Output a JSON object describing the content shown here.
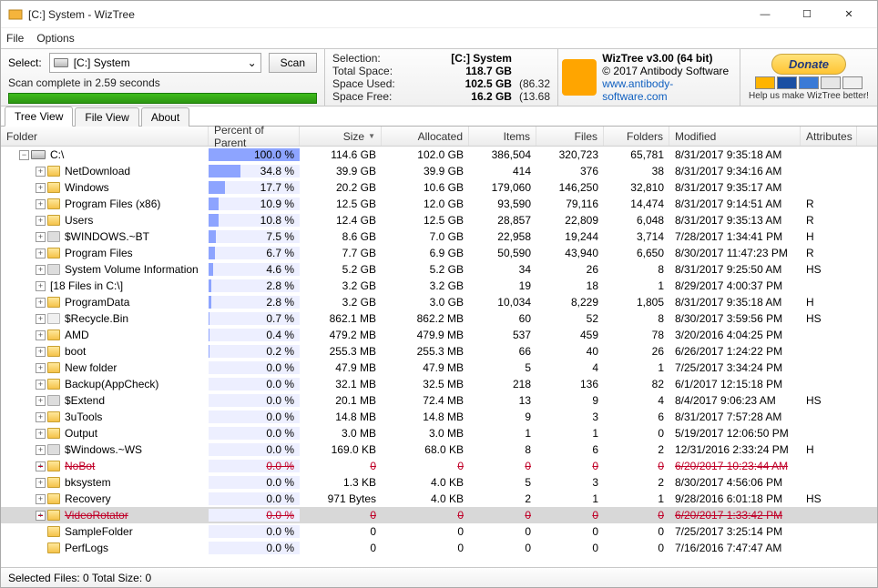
{
  "window": {
    "title": "[C:] System  -  WizTree",
    "menus": [
      "File",
      "Options"
    ]
  },
  "select": {
    "label": "Select:",
    "drive_icon": "drive",
    "drive_text": "[C:] System",
    "scan_btn": "Scan",
    "status": "Scan complete in 2.59 seconds"
  },
  "stats": {
    "sel_label": "Selection:",
    "sel_val": "[C:]  System",
    "total_label": "Total Space:",
    "total_val": "118.7 GB",
    "total_pct": "",
    "used_label": "Space Used:",
    "used_val": "102.5 GB",
    "used_pct": "(86.32",
    "free_label": "Space Free:",
    "free_val": "16.2 GB",
    "free_pct": "(13.68"
  },
  "brand": {
    "name": "WizTree v3.00 (64 bit)",
    "copy": "© 2017 Antibody Software",
    "url": "www.antibody-software.com"
  },
  "donate": {
    "btn": "Donate",
    "help": "Help us make WizTree better!"
  },
  "tabs": [
    "Tree View",
    "File View",
    "About"
  ],
  "columns": {
    "folder": "Folder",
    "pct": "Percent of Parent",
    "size": "Size",
    "alloc": "Allocated",
    "items": "Items",
    "files": "Files",
    "folders": "Folders",
    "mod": "Modified",
    "attr": "Attributes"
  },
  "rows": [
    {
      "depth": 0,
      "exp": "minus",
      "icon": "drive",
      "name": "C:\\",
      "pct": 100.0,
      "pct_s": "100.0 %",
      "size": "114.6 GB",
      "alloc": "102.0 GB",
      "items": "386,504",
      "files": "320,723",
      "folders": "65,781",
      "mod": "8/31/2017 9:35:18 AM",
      "attr": ""
    },
    {
      "depth": 1,
      "exp": "plus",
      "icon": "fld",
      "name": "NetDownload",
      "pct": 34.8,
      "pct_s": "34.8 %",
      "size": "39.9 GB",
      "alloc": "39.9 GB",
      "items": "414",
      "files": "376",
      "folders": "38",
      "mod": "8/31/2017 9:34:16 AM",
      "attr": ""
    },
    {
      "depth": 1,
      "exp": "plus",
      "icon": "fld",
      "name": "Windows",
      "pct": 17.7,
      "pct_s": "17.7 %",
      "size": "20.2 GB",
      "alloc": "10.6 GB",
      "items": "179,060",
      "files": "146,250",
      "folders": "32,810",
      "mod": "8/31/2017 9:35:17 AM",
      "attr": ""
    },
    {
      "depth": 1,
      "exp": "plus",
      "icon": "fld",
      "name": "Program Files (x86)",
      "pct": 10.9,
      "pct_s": "10.9 %",
      "size": "12.5 GB",
      "alloc": "12.0 GB",
      "items": "93,590",
      "files": "79,116",
      "folders": "14,474",
      "mod": "8/31/2017 9:14:51 AM",
      "attr": "R"
    },
    {
      "depth": 1,
      "exp": "plus",
      "icon": "fld",
      "name": "Users",
      "pct": 10.8,
      "pct_s": "10.8 %",
      "size": "12.4 GB",
      "alloc": "12.5 GB",
      "items": "28,857",
      "files": "22,809",
      "folders": "6,048",
      "mod": "8/31/2017 9:35:13 AM",
      "attr": "R"
    },
    {
      "depth": 1,
      "exp": "plus",
      "icon": "sys",
      "name": "$WINDOWS.~BT",
      "pct": 7.5,
      "pct_s": "7.5 %",
      "size": "8.6 GB",
      "alloc": "7.0 GB",
      "items": "22,958",
      "files": "19,244",
      "folders": "3,714",
      "mod": "7/28/2017 1:34:41 PM",
      "attr": "H"
    },
    {
      "depth": 1,
      "exp": "plus",
      "icon": "fld",
      "name": "Program Files",
      "pct": 6.7,
      "pct_s": "6.7 %",
      "size": "7.7 GB",
      "alloc": "6.9 GB",
      "items": "50,590",
      "files": "43,940",
      "folders": "6,650",
      "mod": "8/30/2017 11:47:23 PM",
      "attr": "R"
    },
    {
      "depth": 1,
      "exp": "plus",
      "icon": "sys",
      "name": "System Volume Information",
      "pct": 4.6,
      "pct_s": "4.6 %",
      "size": "5.2 GB",
      "alloc": "5.2 GB",
      "items": "34",
      "files": "26",
      "folders": "8",
      "mod": "8/31/2017 9:25:50 AM",
      "attr": "HS"
    },
    {
      "depth": 1,
      "exp": "plus",
      "icon": "none",
      "name": "[18 Files in C:\\]",
      "pct": 2.8,
      "pct_s": "2.8 %",
      "size": "3.2 GB",
      "alloc": "3.2 GB",
      "items": "19",
      "files": "18",
      "folders": "1",
      "mod": "8/29/2017 4:00:37 PM",
      "attr": ""
    },
    {
      "depth": 1,
      "exp": "plus",
      "icon": "fld",
      "name": "ProgramData",
      "pct": 2.8,
      "pct_s": "2.8 %",
      "size": "3.2 GB",
      "alloc": "3.0 GB",
      "items": "10,034",
      "files": "8,229",
      "folders": "1,805",
      "mod": "8/31/2017 9:35:18 AM",
      "attr": "H"
    },
    {
      "depth": 1,
      "exp": "plus",
      "icon": "bin",
      "name": "$Recycle.Bin",
      "pct": 0.7,
      "pct_s": "0.7 %",
      "size": "862.1 MB",
      "alloc": "862.2 MB",
      "items": "60",
      "files": "52",
      "folders": "8",
      "mod": "8/30/2017 3:59:56 PM",
      "attr": "HS"
    },
    {
      "depth": 1,
      "exp": "plus",
      "icon": "fld",
      "name": "AMD",
      "pct": 0.4,
      "pct_s": "0.4 %",
      "size": "479.2 MB",
      "alloc": "479.9 MB",
      "items": "537",
      "files": "459",
      "folders": "78",
      "mod": "3/20/2016 4:04:25 PM",
      "attr": ""
    },
    {
      "depth": 1,
      "exp": "plus",
      "icon": "fld",
      "name": "boot",
      "pct": 0.2,
      "pct_s": "0.2 %",
      "size": "255.3 MB",
      "alloc": "255.3 MB",
      "items": "66",
      "files": "40",
      "folders": "26",
      "mod": "6/26/2017 1:24:22 PM",
      "attr": ""
    },
    {
      "depth": 1,
      "exp": "plus",
      "icon": "fld",
      "name": "New folder",
      "pct": 0.0,
      "pct_s": "0.0 %",
      "size": "47.9 MB",
      "alloc": "47.9 MB",
      "items": "5",
      "files": "4",
      "folders": "1",
      "mod": "7/25/2017 3:34:24 PM",
      "attr": ""
    },
    {
      "depth": 1,
      "exp": "plus",
      "icon": "fld",
      "name": "Backup(AppCheck)",
      "pct": 0.0,
      "pct_s": "0.0 %",
      "size": "32.1 MB",
      "alloc": "32.5 MB",
      "items": "218",
      "files": "136",
      "folders": "82",
      "mod": "6/1/2017 12:15:18 PM",
      "attr": ""
    },
    {
      "depth": 1,
      "exp": "plus",
      "icon": "sys",
      "name": "$Extend",
      "pct": 0.0,
      "pct_s": "0.0 %",
      "size": "20.1 MB",
      "alloc": "72.4 MB",
      "items": "13",
      "files": "9",
      "folders": "4",
      "mod": "8/4/2017 9:06:23 AM",
      "attr": "HS"
    },
    {
      "depth": 1,
      "exp": "plus",
      "icon": "fld",
      "name": "3uTools",
      "pct": 0.0,
      "pct_s": "0.0 %",
      "size": "14.8 MB",
      "alloc": "14.8 MB",
      "items": "9",
      "files": "3",
      "folders": "6",
      "mod": "8/31/2017 7:57:28 AM",
      "attr": ""
    },
    {
      "depth": 1,
      "exp": "plus",
      "icon": "fld",
      "name": "Output",
      "pct": 0.0,
      "pct_s": "0.0 %",
      "size": "3.0 MB",
      "alloc": "3.0 MB",
      "items": "1",
      "files": "1",
      "folders": "0",
      "mod": "5/19/2017 12:06:50 PM",
      "attr": ""
    },
    {
      "depth": 1,
      "exp": "plus",
      "icon": "sys",
      "name": "$Windows.~WS",
      "pct": 0.0,
      "pct_s": "0.0 %",
      "size": "169.0 KB",
      "alloc": "68.0 KB",
      "items": "8",
      "files": "6",
      "folders": "2",
      "mod": "12/31/2016 2:33:24 PM",
      "attr": "H"
    },
    {
      "depth": 1,
      "exp": "plus",
      "icon": "fld",
      "name": "NoBot",
      "pct": 0.0,
      "pct_s": "0.0 %",
      "size": "0",
      "alloc": "0",
      "items": "0",
      "files": "0",
      "folders": "0",
      "mod": "6/20/2017 10:23:44 AM",
      "attr": "",
      "strike": true
    },
    {
      "depth": 1,
      "exp": "plus",
      "icon": "fld",
      "name": "bksystem",
      "pct": 0.0,
      "pct_s": "0.0 %",
      "size": "1.3 KB",
      "alloc": "4.0 KB",
      "items": "5",
      "files": "3",
      "folders": "2",
      "mod": "8/30/2017 4:56:06 PM",
      "attr": ""
    },
    {
      "depth": 1,
      "exp": "plus",
      "icon": "fld",
      "name": "Recovery",
      "pct": 0.0,
      "pct_s": "0.0 %",
      "size": "971 Bytes",
      "alloc": "4.0 KB",
      "items": "2",
      "files": "1",
      "folders": "1",
      "mod": "9/28/2016 6:01:18 PM",
      "attr": "HS"
    },
    {
      "depth": 1,
      "exp": "plus",
      "icon": "fld",
      "name": "VideoRotator",
      "pct": 0.0,
      "pct_s": "0.0 %",
      "size": "0",
      "alloc": "0",
      "items": "0",
      "files": "0",
      "folders": "0",
      "mod": "6/20/2017 1:33:42 PM",
      "attr": "",
      "strike": true,
      "sel": true
    },
    {
      "depth": 1,
      "exp": "none",
      "icon": "fld",
      "name": "SampleFolder",
      "pct": 0.0,
      "pct_s": "0.0 %",
      "size": "0",
      "alloc": "0",
      "items": "0",
      "files": "0",
      "folders": "0",
      "mod": "7/25/2017 3:25:14 PM",
      "attr": ""
    },
    {
      "depth": 1,
      "exp": "none",
      "icon": "fld",
      "name": "PerfLogs",
      "pct": 0.0,
      "pct_s": "0.0 %",
      "size": "0",
      "alloc": "0",
      "items": "0",
      "files": "0",
      "folders": "0",
      "mod": "7/16/2016 7:47:47 AM",
      "attr": ""
    }
  ],
  "statusbar": "Selected Files: 0  Total Size: 0"
}
